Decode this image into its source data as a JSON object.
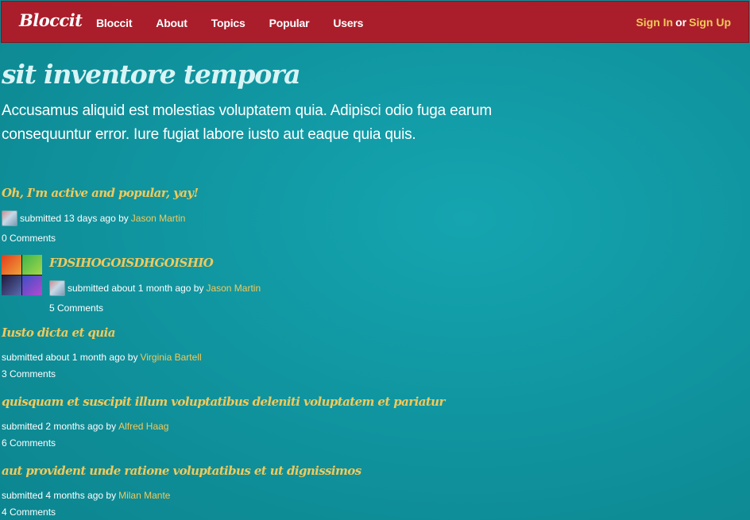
{
  "nav": {
    "brand": "Bloccit",
    "links": [
      "Bloccit",
      "About",
      "Topics",
      "Popular",
      "Users"
    ],
    "sign_in": "Sign In",
    "or": "or",
    "sign_up": "Sign Up"
  },
  "topic": {
    "title": "sit inventore tempora",
    "description": "Accusamus aliquid est molestias voluptatem quia. Adipisci odio fuga earum consequuntur error. Iure fugiat labore iusto aut eaque quia quis."
  },
  "posts": [
    {
      "title": "Oh, I'm active and popular, yay!",
      "submitted": "submitted 13 days ago by",
      "author": "Jason Martin",
      "comments": "0 Comments"
    },
    {
      "title": "FDSIHOGOISDHGOISHIO",
      "submitted": "submitted about 1 month ago by",
      "author": "Jason Martin",
      "comments": "5 Comments"
    },
    {
      "title": "Iusto dicta et quia",
      "submitted": "submitted about 1 month ago by",
      "author": "Virginia Bartell",
      "comments": "3 Comments"
    },
    {
      "title": "quisquam et suscipit illum voluptatibus deleniti voluptatem et pariatur",
      "submitted": "submitted 2 months ago by",
      "author": "Alfred Haag",
      "comments": "6 Comments"
    },
    {
      "title": "aut provident unde ratione voluptatibus et ut dignissimos",
      "submitted": "submitted 4 months ago by",
      "author": "Milan Mante",
      "comments": "4 Comments"
    }
  ],
  "colors": {
    "navbar": "#aa1e2b",
    "background": "#1199a4",
    "accent": "#f2c95a"
  }
}
